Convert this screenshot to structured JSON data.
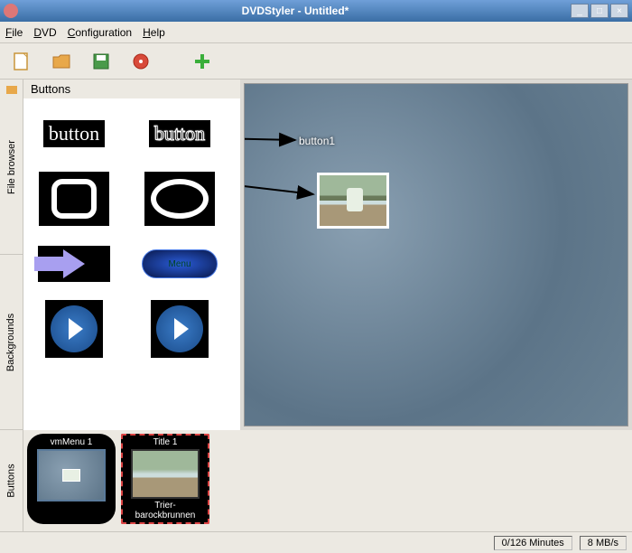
{
  "window": {
    "title": "DVDStyler - Untitled*",
    "controls": {
      "min": "_",
      "max": "□",
      "close": "×"
    }
  },
  "menu": {
    "file": "File",
    "dvd": "DVD",
    "config": "Configuration",
    "help": "Help"
  },
  "sidebar_tabs": {
    "file_browser": "File browser",
    "backgrounds": "Backgrounds",
    "buttons": "Buttons"
  },
  "panel": {
    "header": "Buttons",
    "items": {
      "text1": "button",
      "text2": "button",
      "pill_label": "Menu"
    }
  },
  "canvas": {
    "button_label": "button1"
  },
  "timeline": {
    "item1": {
      "title": "vmMenu 1"
    },
    "item2": {
      "title": "Title 1",
      "subtitle": "Trier-barockbrunnen"
    }
  },
  "status": {
    "minutes": "0/126 Minutes",
    "bitrate": "8 MB/s"
  }
}
